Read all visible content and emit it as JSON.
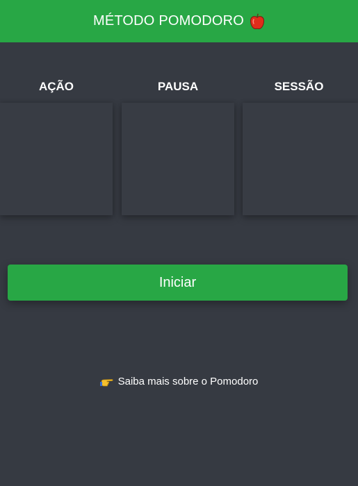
{
  "header": {
    "title": "MÉTODO POMODORO",
    "icon": "apple-icon"
  },
  "columns": [
    {
      "label": "AÇÃO"
    },
    {
      "label": "PAUSA"
    },
    {
      "label": "SESSÃO"
    }
  ],
  "start_button": {
    "label": "Iniciar"
  },
  "learn_more": {
    "icon": "pointing-hand-icon",
    "text": "Saiba mais sobre o Pomodoro"
  },
  "colors": {
    "accent": "#28a745",
    "background": "#363a42",
    "panel": "#383c44",
    "text": "#ffffff"
  }
}
